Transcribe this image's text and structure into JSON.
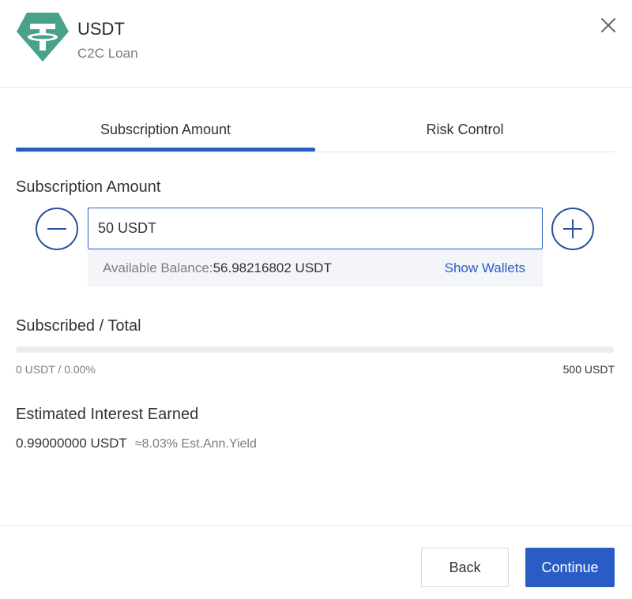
{
  "header": {
    "title": "USDT",
    "subtitle": "C2C Loan",
    "logo_color": "#48a188"
  },
  "tabs": [
    {
      "label": "Subscription Amount",
      "active": true
    },
    {
      "label": "Risk Control",
      "active": false
    }
  ],
  "subscription": {
    "label": "Subscription Amount",
    "input_value": "50 USDT",
    "balance_label": "Available Balance:",
    "balance_value": "56.98216802 USDT",
    "show_wallets": "Show Wallets"
  },
  "progress": {
    "label": "Subscribed / Total",
    "left_text": "0 USDT / 0.00%",
    "right_text": "500 USDT",
    "fraction": 0.0
  },
  "interest": {
    "label": "Estimated Interest Earned",
    "amount": "0.99000000 USDT",
    "yield": "≈8.03% Est.Ann.Yield"
  },
  "footer": {
    "back_label": "Back",
    "continue_label": "Continue"
  },
  "colors": {
    "accent": "#2a5cc6",
    "stepper": "#2a4f9e",
    "logo": "#48a188"
  },
  "icons": {
    "logo": "tether-icon",
    "close": "close-icon",
    "decrement": "minus-icon",
    "increment": "plus-icon"
  }
}
